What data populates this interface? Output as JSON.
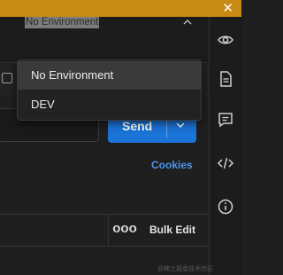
{
  "window": {
    "close_icon": "close-icon"
  },
  "environment": {
    "selected": "No Environment",
    "chevron_icon": "chevron-up-icon",
    "options": [
      {
        "label": "No Environment",
        "active": true
      },
      {
        "label": "DEV",
        "active": false
      }
    ]
  },
  "request": {
    "send_label": "Send",
    "cookies_label": "Cookies",
    "more_label": "ooo",
    "bulk_edit_label": "Bulk Edit"
  },
  "sidebar": {
    "icons": [
      "eye-icon",
      "document-icon",
      "comment-icon",
      "code-icon",
      "info-icon"
    ]
  },
  "watermark": "@稀土掘金技术社区",
  "colors": {
    "topbar": "#c98a13",
    "accent": "#1b74d8",
    "link": "#4a95ee",
    "background": "#1f1f1f"
  }
}
